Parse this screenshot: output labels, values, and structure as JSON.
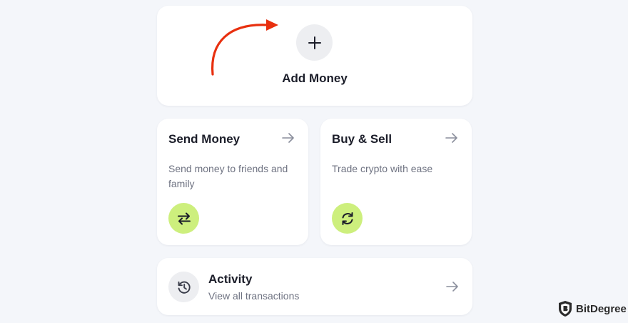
{
  "add_money": {
    "label": "Add Money",
    "icon": "plus-icon"
  },
  "annotation": {
    "color": "#e8300f",
    "icon": "curved-arrow-annotation"
  },
  "send_money": {
    "title": "Send Money",
    "description": "Send money to friends and family",
    "icon": "swap-arrows-icon",
    "nav_icon": "arrow-right-icon"
  },
  "buy_sell": {
    "title": "Buy & Sell",
    "description": "Trade crypto with ease",
    "icon": "refresh-icon",
    "nav_icon": "arrow-right-icon"
  },
  "activity": {
    "title": "Activity",
    "subtitle": "View all transactions",
    "icon": "history-icon",
    "nav_icon": "arrow-right-icon"
  },
  "watermark": {
    "text": "BitDegree",
    "icon": "bitdegree-shield-logo"
  },
  "colors": {
    "background": "#f4f6fa",
    "card": "#ffffff",
    "accent_green": "#cdef7d",
    "icon_circle_gray": "#edeef1",
    "title_text": "#1b1d29",
    "muted_text": "#6f7382",
    "annotation_red": "#e8300f"
  }
}
